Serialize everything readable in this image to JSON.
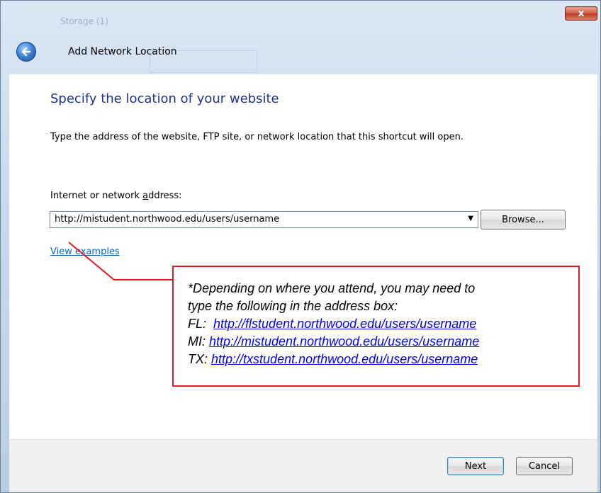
{
  "window": {
    "title": "Add Network Location",
    "background_text": "Storage (1)",
    "close_glyph": "x"
  },
  "page": {
    "heading": "Specify the location of your website",
    "instruction": "Type the address of the website, FTP site, or network location that this shortcut will open.",
    "field_label_prefix": "Internet or network ",
    "field_label_accel": "a",
    "field_label_suffix": "ddress:",
    "address_value": "http://mistudent.northwood.edu/users/username",
    "browse_label": "Browse...",
    "view_examples_label": "View examples"
  },
  "callout": {
    "intro_line1": "*Depending on where you attend, you may need to",
    "intro_line2": "type the following in the address box:",
    "entries": [
      {
        "prefix": "FL:  ",
        "url": "http://flstudent.northwood.edu/users/username"
      },
      {
        "prefix": "MI: ",
        "url": "http://mistudent.northwood.edu/users/username"
      },
      {
        "prefix": "TX: ",
        "url": "http://txstudent.northwood.edu/users/username"
      }
    ]
  },
  "footer": {
    "next_label": "Next",
    "cancel_label": "Cancel"
  },
  "colors": {
    "heading": "#1e3287",
    "link": "#0066cc",
    "callout_border": "#e31b23",
    "callout_link": "#0000ee"
  },
  "icons": {
    "back": "back-arrow-icon",
    "close": "close-icon",
    "dropdown": "chevron-down-icon"
  }
}
